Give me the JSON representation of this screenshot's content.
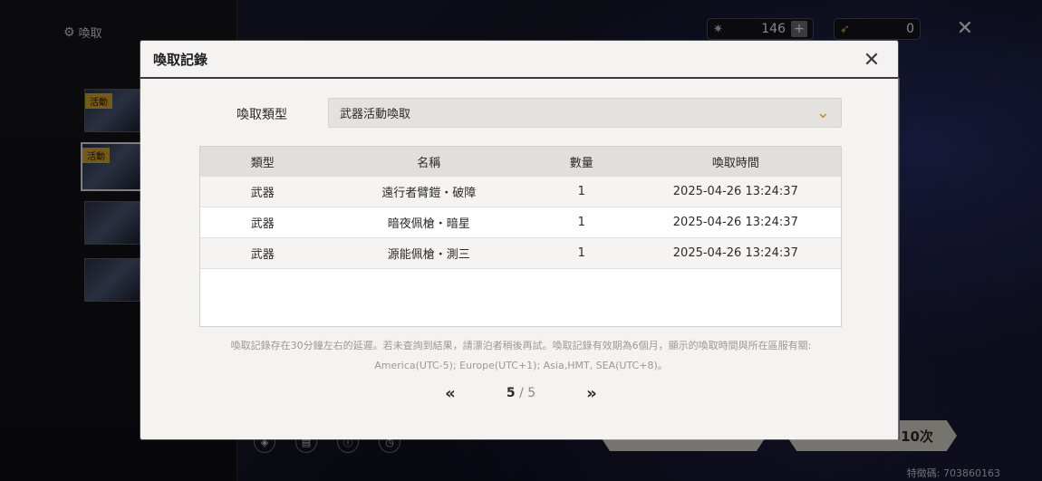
{
  "background": {
    "nav_title": "喚取",
    "nav_icon": "settings-gear-icon",
    "banners": [
      {
        "tag": "活動"
      },
      {
        "tag": "活動"
      },
      {
        "tag": ""
      },
      {
        "tag": ""
      }
    ],
    "currencies": [
      {
        "icon": "star-token-icon",
        "value": "146"
      },
      {
        "icon": "feather-token-icon",
        "value": "0"
      }
    ],
    "pull_ten_label": "10次",
    "uid": "特徵碼: 703860163"
  },
  "modal": {
    "title": "喚取記錄",
    "filter_label": "喚取類型",
    "filter_value": "武器活動喚取",
    "table": {
      "headers": [
        "類型",
        "名稱",
        "數量",
        "喚取時間"
      ],
      "rows": [
        {
          "type": "武器",
          "name": "遠行者臂鎧・破障",
          "qty": "1",
          "time": "2025-04-26 13:24:37"
        },
        {
          "type": "武器",
          "name": "暗夜佩槍・暗星",
          "qty": "1",
          "time": "2025-04-26 13:24:37"
        },
        {
          "type": "武器",
          "name": "源能佩槍・測三",
          "qty": "1",
          "time": "2025-04-26 13:24:37"
        }
      ]
    },
    "note_line1": "喚取記錄存在30分鐘左右的延遲。若未查詢到結果，請漂泊者稍後再試。喚取記錄有效期為6個月，顯示的喚取時間與所在區服有關:",
    "note_line2": "America(UTC-5); Europe(UTC+1); Asia,HMT, SEA(UTC+8)。",
    "pagination": {
      "current": "5",
      "total": "/ 5"
    }
  }
}
